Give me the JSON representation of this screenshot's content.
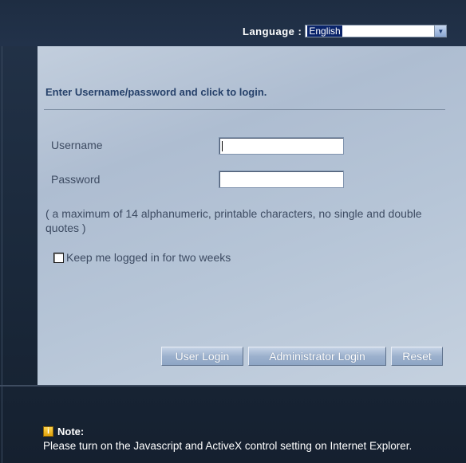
{
  "language": {
    "label": "Language :",
    "selected": "English",
    "dropdown_icon": "chevron-down-icon"
  },
  "login": {
    "title": "Enter Username/password and click to login.",
    "username_label": "Username",
    "username_value": "",
    "password_label": "Password",
    "password_value": "",
    "hint": "( a maximum of 14 alphanumeric, printable characters, no single and double quotes )",
    "keep_logged_in_label": "Keep me logged in for two weeks",
    "keep_logged_in_checked": false
  },
  "buttons": {
    "user_login": "User Login",
    "admin_login": "Administrator Login",
    "reset": "Reset"
  },
  "note": {
    "icon": "info-icon",
    "title": "Note:",
    "text": "Please turn on the Javascript and ActiveX control setting on Internet Explorer."
  }
}
